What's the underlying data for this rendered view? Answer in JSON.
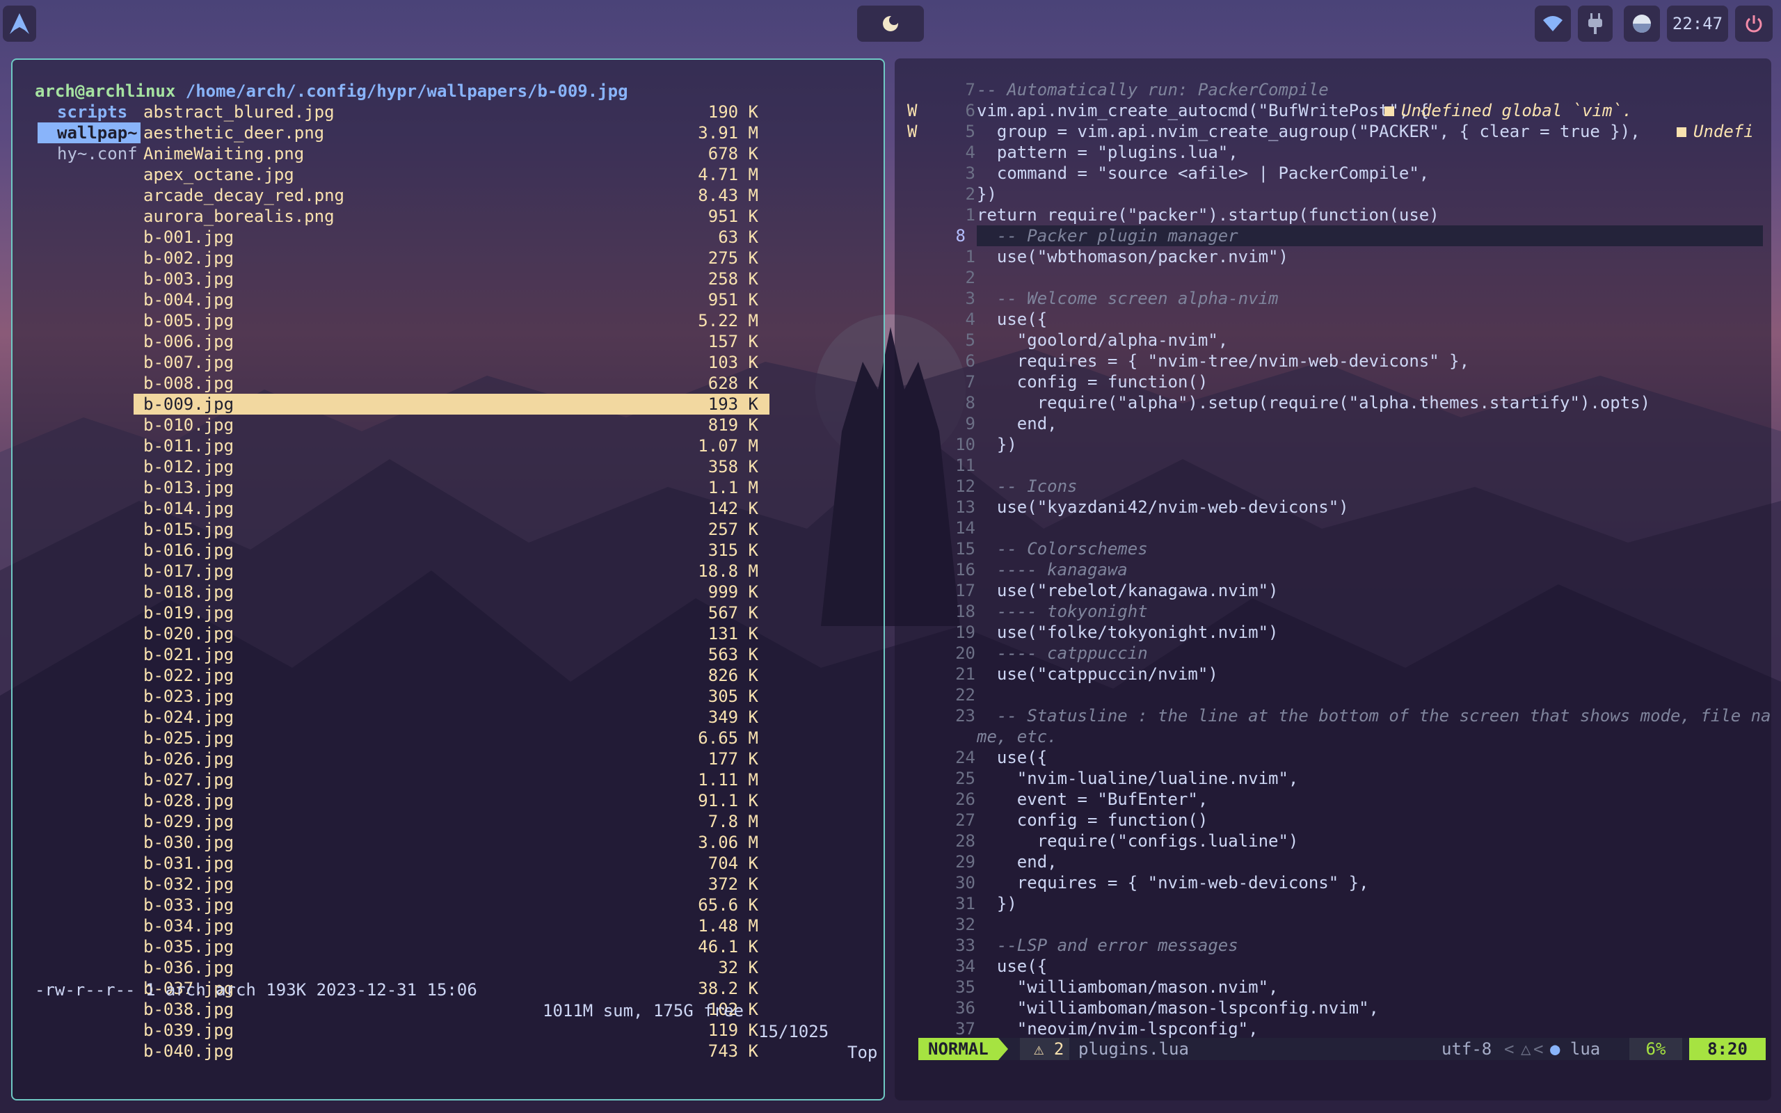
{
  "topbar": {
    "clock": "22:47",
    "icons": [
      "arch-logo-icon",
      "moon-icon",
      "wifi-icon",
      "plug-icon",
      "display-icon",
      "power-icon"
    ]
  },
  "file_manager": {
    "user": "arch@archlinux",
    "path": "/home/arch/.config/hypr/wallpapers/b-009.jpg",
    "parent_items": [
      "scripts",
      "wallpap~",
      "hy~.conf"
    ],
    "files": [
      {
        "name": "abstract_blured.jpg",
        "size": "190 K"
      },
      {
        "name": "aesthetic_deer.png",
        "size": "3.91 M"
      },
      {
        "name": "AnimeWaiting.png",
        "size": "678 K"
      },
      {
        "name": "apex_octane.jpg",
        "size": "4.71 M"
      },
      {
        "name": "arcade_decay_red.png",
        "size": "8.43 M"
      },
      {
        "name": "aurora_borealis.png",
        "size": "951 K"
      },
      {
        "name": "b-001.jpg",
        "size": "63 K"
      },
      {
        "name": "b-002.jpg",
        "size": "275 K"
      },
      {
        "name": "b-003.jpg",
        "size": "258 K"
      },
      {
        "name": "b-004.jpg",
        "size": "951 K"
      },
      {
        "name": "b-005.jpg",
        "size": "5.22 M"
      },
      {
        "name": "b-006.jpg",
        "size": "157 K"
      },
      {
        "name": "b-007.jpg",
        "size": "103 K"
      },
      {
        "name": "b-008.jpg",
        "size": "628 K"
      },
      {
        "name": "b-009.jpg",
        "size": "193 K"
      },
      {
        "name": "b-010.jpg",
        "size": "819 K"
      },
      {
        "name": "b-011.jpg",
        "size": "1.07 M"
      },
      {
        "name": "b-012.jpg",
        "size": "358 K"
      },
      {
        "name": "b-013.jpg",
        "size": "1.1 M"
      },
      {
        "name": "b-014.jpg",
        "size": "142 K"
      },
      {
        "name": "b-015.jpg",
        "size": "257 K"
      },
      {
        "name": "b-016.jpg",
        "size": "315 K"
      },
      {
        "name": "b-017.jpg",
        "size": "18.8 M"
      },
      {
        "name": "b-018.jpg",
        "size": "999 K"
      },
      {
        "name": "b-019.jpg",
        "size": "567 K"
      },
      {
        "name": "b-020.jpg",
        "size": "131 K"
      },
      {
        "name": "b-021.jpg",
        "size": "563 K"
      },
      {
        "name": "b-022.jpg",
        "size": "826 K"
      },
      {
        "name": "b-023.jpg",
        "size": "305 K"
      },
      {
        "name": "b-024.jpg",
        "size": "349 K"
      },
      {
        "name": "b-025.jpg",
        "size": "6.65 M"
      },
      {
        "name": "b-026.jpg",
        "size": "177 K"
      },
      {
        "name": "b-027.jpg",
        "size": "1.11 M"
      },
      {
        "name": "b-028.jpg",
        "size": "91.1 K"
      },
      {
        "name": "b-029.jpg",
        "size": "7.8 M"
      },
      {
        "name": "b-030.jpg",
        "size": "3.06 M"
      },
      {
        "name": "b-031.jpg",
        "size": "704 K"
      },
      {
        "name": "b-032.jpg",
        "size": "372 K"
      },
      {
        "name": "b-033.jpg",
        "size": "65.6 K"
      },
      {
        "name": "b-034.jpg",
        "size": "1.48 M"
      },
      {
        "name": "b-035.jpg",
        "size": "46.1 K"
      },
      {
        "name": "b-036.jpg",
        "size": "32 K"
      },
      {
        "name": "b-037.jpg",
        "size": "38.2 K"
      },
      {
        "name": "b-038.jpg",
        "size": "102 K"
      },
      {
        "name": "b-039.jpg",
        "size": "119 K"
      },
      {
        "name": "b-040.jpg",
        "size": "743 K"
      }
    ],
    "selected_file": "b-009.jpg",
    "status": {
      "permissions": "-rw-r--r-- 1 arch arch 193K 2023-12-31 15:06",
      "summary": "1011M sum, 175G free",
      "position": "15/1025",
      "scroll": "Top"
    }
  },
  "editor": {
    "diagnostics": [
      "Undefined global `vim`.",
      "Undefi"
    ],
    "lines": [
      {
        "sign": "",
        "num": "7",
        "code": "-- Automatically run: PackerCompile"
      },
      {
        "sign": "W",
        "num": "6",
        "code": "vim.api.nvim_create_autocmd(\"BufWritePost\", {"
      },
      {
        "sign": "W",
        "num": "5",
        "code": "  group = vim.api.nvim_create_augroup(\"PACKER\", { clear = true }),"
      },
      {
        "sign": "",
        "num": "4",
        "code": "  pattern = \"plugins.lua\","
      },
      {
        "sign": "",
        "num": "3",
        "code": "  command = \"source <afile> | PackerCompile\","
      },
      {
        "sign": "",
        "num": "2",
        "code": "})"
      },
      {
        "sign": "",
        "num": "1",
        "code": "return require(\"packer\").startup(function(use)"
      },
      {
        "sign": "",
        "num": "8",
        "code": "  -- Packer plugin manager"
      },
      {
        "sign": "",
        "num": "1",
        "code": "  use(\"wbthomason/packer.nvim\")"
      },
      {
        "sign": "",
        "num": "2",
        "code": ""
      },
      {
        "sign": "",
        "num": "3",
        "code": "  -- Welcome screen alpha-nvim"
      },
      {
        "sign": "",
        "num": "4",
        "code": "  use({"
      },
      {
        "sign": "",
        "num": "5",
        "code": "    \"goolord/alpha-nvim\","
      },
      {
        "sign": "",
        "num": "6",
        "code": "    requires = { \"nvim-tree/nvim-web-devicons\" },"
      },
      {
        "sign": "",
        "num": "7",
        "code": "    config = function()"
      },
      {
        "sign": "",
        "num": "8",
        "code": "      require(\"alpha\").setup(require(\"alpha.themes.startify\").opts)"
      },
      {
        "sign": "",
        "num": "9",
        "code": "    end,"
      },
      {
        "sign": "",
        "num": "10",
        "code": "  })"
      },
      {
        "sign": "",
        "num": "11",
        "code": ""
      },
      {
        "sign": "",
        "num": "12",
        "code": "  -- Icons"
      },
      {
        "sign": "",
        "num": "13",
        "code": "  use(\"kyazdani42/nvim-web-devicons\")"
      },
      {
        "sign": "",
        "num": "14",
        "code": ""
      },
      {
        "sign": "",
        "num": "15",
        "code": "  -- Colorschemes"
      },
      {
        "sign": "",
        "num": "16",
        "code": "  ---- kanagawa"
      },
      {
        "sign": "",
        "num": "17",
        "code": "  use(\"rebelot/kanagawa.nvim\")"
      },
      {
        "sign": "",
        "num": "18",
        "code": "  ---- tokyonight"
      },
      {
        "sign": "",
        "num": "19",
        "code": "  use(\"folke/tokyonight.nvim\")"
      },
      {
        "sign": "",
        "num": "20",
        "code": "  ---- catppuccin"
      },
      {
        "sign": "",
        "num": "21",
        "code": "  use(\"catppuccin/nvim\")"
      },
      {
        "sign": "",
        "num": "22",
        "code": ""
      },
      {
        "sign": "",
        "num": "23",
        "code": "  -- Statusline : the line at the bottom of the screen that shows mode, file na"
      },
      {
        "sign": "",
        "num": "",
        "code": "me, etc."
      },
      {
        "sign": "",
        "num": "24",
        "code": "  use({"
      },
      {
        "sign": "",
        "num": "25",
        "code": "    \"nvim-lualine/lualine.nvim\","
      },
      {
        "sign": "",
        "num": "26",
        "code": "    event = \"BufEnter\","
      },
      {
        "sign": "",
        "num": "27",
        "code": "    config = function()"
      },
      {
        "sign": "",
        "num": "28",
        "code": "      require(\"configs.lualine\")"
      },
      {
        "sign": "",
        "num": "29",
        "code": "    end,"
      },
      {
        "sign": "",
        "num": "30",
        "code": "    requires = { \"nvim-web-devicons\" },"
      },
      {
        "sign": "",
        "num": "31",
        "code": "  })"
      },
      {
        "sign": "",
        "num": "32",
        "code": ""
      },
      {
        "sign": "",
        "num": "33",
        "code": "  --LSP and error messages"
      },
      {
        "sign": "",
        "num": "34",
        "code": "  use({"
      },
      {
        "sign": "",
        "num": "35",
        "code": "    \"williamboman/mason.nvim\","
      },
      {
        "sign": "",
        "num": "36",
        "code": "    \"williamboman/mason-lspconfig.nvim\","
      },
      {
        "sign": "",
        "num": "37",
        "code": "    \"neovim/nvim-lspconfig\","
      }
    ],
    "statusline": {
      "mode": "NORMAL",
      "warnings": "⚠ 2",
      "filename": "plugins.lua",
      "encoding": "utf-8",
      "filetype": "lua",
      "percent": "6%",
      "position": "8:20"
    }
  },
  "colors": {
    "accent_green": "#a6e341",
    "folder_blue": "#89b4fa",
    "file_yellow": "#f9e2af",
    "frame_teal": "#6fc9c4"
  }
}
